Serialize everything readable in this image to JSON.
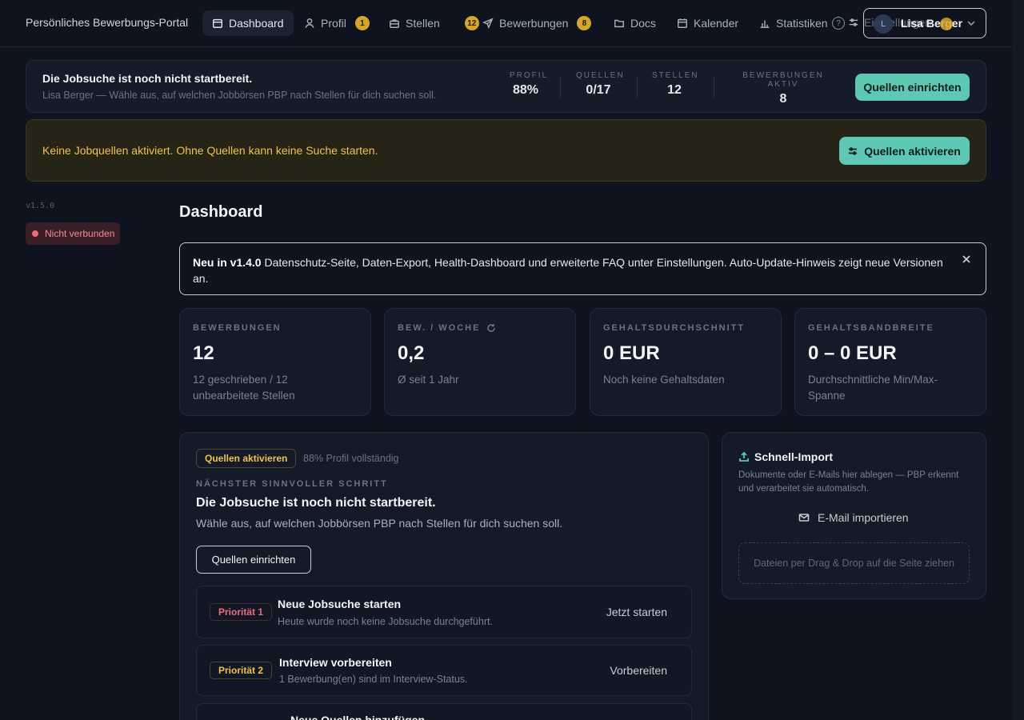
{
  "app": {
    "title": "Persönliches Bewerbungs-Portal",
    "version": "v1.5.0",
    "connection_status": "Nicht verbunden"
  },
  "nav": {
    "items": [
      {
        "label": "Dashboard",
        "icon": "calendar-grid-icon",
        "badge": null,
        "active": true
      },
      {
        "label": "Profil",
        "icon": "user-icon",
        "badge": "1"
      },
      {
        "label": "Stellen",
        "icon": "briefcase-icon",
        "badge": "12"
      },
      {
        "label": "Bewerbungen",
        "icon": "send-icon",
        "badge": "8"
      },
      {
        "label": "Docs",
        "icon": "folder-icon",
        "badge": null
      },
      {
        "label": "Kalender",
        "icon": "calendar-icon",
        "badge": null
      },
      {
        "label": "Statistiken",
        "icon": "bar-chart-icon",
        "badge": null
      }
    ],
    "help_icon": "?",
    "settings_label": "Einstellungen",
    "user": {
      "name": "Lisa Berger",
      "initial": "L"
    }
  },
  "status": {
    "title": "Die Jobsuche ist noch nicht startbereit.",
    "subtitle": "Lisa Berger — Wähle aus, auf welchen Jobbörsen PBP nach Stellen für dich suchen soll.",
    "kpis": [
      {
        "label": "Profil",
        "value": "88%"
      },
      {
        "label": "Quellen",
        "value": "0/17"
      },
      {
        "label": "Stellen",
        "value": "12"
      },
      {
        "label": "Bewerbungen aktiv",
        "value": "8"
      }
    ],
    "cta": "Quellen einrichten"
  },
  "warning": {
    "text": "Keine Jobquellen aktiviert. Ohne Quellen kann keine Suche starten.",
    "cta": "Quellen aktivieren"
  },
  "page_title": "Dashboard",
  "news": {
    "lead": "Neu in v1.4.0",
    "text": " Datenschutz-Seite, Daten-Export, Health-Dashboard und erweiterte FAQ unter Einstellungen. Auto-Update-Hinweis zeigt neue Versionen an."
  },
  "stats": [
    {
      "label": "Bewerbungen",
      "value": "12",
      "sub": "12 geschrieben / 12 unbearbeitete Stellen"
    },
    {
      "label": "Bew. / Woche",
      "value": "0,2",
      "sub": "Ø seit 1 Jahr"
    },
    {
      "label": "Gehaltsdurchschnitt",
      "value": "0 EUR",
      "sub": "Noch keine Gehaltsdaten"
    },
    {
      "label": "Gehaltsbandbreite",
      "value": "0 – 0 EUR",
      "sub": "Durchschnittliche Min/Max-Spanne"
    }
  ],
  "next_step": {
    "pill": "Quellen aktivieren",
    "pill_note": "88% Profil vollständig",
    "label": "NÄCHSTER SINNVOLLER SCHRITT",
    "title": "Die Jobsuche ist noch nicht startbereit.",
    "subtitle": "Wähle aus, auf welchen Jobbörsen PBP nach Stellen für dich suchen soll.",
    "cta": "Quellen einrichten"
  },
  "tasks": [
    {
      "priority": "Priorität 1",
      "title": "Neue Jobsuche starten",
      "sub": "Heute wurde noch keine Jobsuche durchgeführt.",
      "action": "Jetzt starten"
    },
    {
      "priority": "Priorität 2",
      "title": "Interview vorbereiten",
      "sub": "1 Bewerbung(en) sind im Interview-Status.",
      "action": "Vorbereiten"
    },
    {
      "priority": "",
      "title": "Neue Quellen hinzufügen",
      "sub": "",
      "action": ""
    }
  ],
  "quick_import": {
    "title": "Schnell-Import",
    "desc": "Dokumente oder E-Mails hier ablegen — PBP erkennt und verarbeitet sie automatisch.",
    "mail_label": "E-Mail importieren",
    "dropzone": "Dateien per Drag & Drop auf die Seite ziehen"
  }
}
